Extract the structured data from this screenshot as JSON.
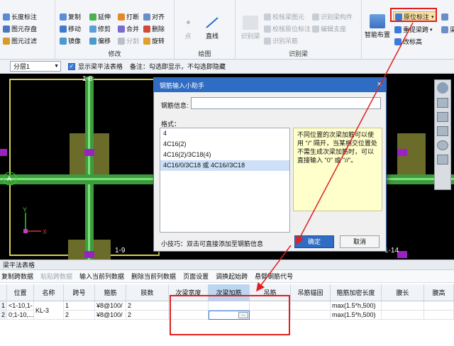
{
  "ribbon": {
    "g1": {
      "items": [
        "长度标注",
        "图元存盘",
        "图元过滤"
      ]
    },
    "g2": {
      "items": [
        [
          "复制",
          "延伸",
          "打断",
          "对齐"
        ],
        [
          "移动",
          "修剪",
          "合并",
          "删除"
        ],
        [
          "镜像",
          "偏移",
          "分割",
          "旋转"
        ]
      ],
      "label": "修改"
    },
    "g3": {
      "items": [
        "点",
        "直线"
      ],
      "label": "绘图"
    },
    "g4": {
      "items": [
        "识别梁",
        "校核梁图元",
        "识别梁构件",
        "校核原位标注",
        "编辑支座",
        "识别吊筋"
      ],
      "label": "识别梁"
    },
    "g5": {
      "smart_layout": "智能布置",
      "orig_mark": "原位标注",
      "redo_span": "重提梁跨",
      "change_elev": "改标高",
      "liang": "梁"
    }
  },
  "toolbar2": {
    "floor": "分层1",
    "show_table": "显示梁平法表格",
    "note": "备注：勾选即显示，不勾选即隐藏"
  },
  "canvas": {
    "labels": [
      "1-8",
      "1-9",
      "1-14",
      "A"
    ]
  },
  "dialog": {
    "title": "钢筋输入小助手",
    "close": "×",
    "rebar_info_label": "钢筋信息:",
    "rebar_info_value": "",
    "format_label": "格式：",
    "formats": [
      "4",
      "4C16(2)",
      "4C16(2)/3C18(4)",
      "4C16/0/3C18 或 4C16//3C18"
    ],
    "hint": "不同位置的次梁加筋可以使用 \"/\" 隔开，当某相交位置处不需生成次梁加筋时，可以直接输入 \"0\" 或 \"//\"。",
    "tip": "小技巧：双击可直接添加至钢筋信息",
    "ok": "确定",
    "cancel": "取消"
  },
  "table": {
    "title": "梁平法表格",
    "toolbar": [
      "复制跨数据",
      "粘贴跨数据",
      "输入当前列数据",
      "删除当前列数据",
      "页面设置",
      "调换起始跨",
      "悬臂钢筋代号"
    ],
    "headers": [
      "位置",
      "名称",
      "跨号",
      "箍筋",
      "肢数",
      "次梁宽度",
      "次梁加筋",
      "吊筋",
      "吊筋锚固",
      "箍筋加密长度",
      "腹长",
      "腹高"
    ],
    "rows": [
      {
        "idx": "1",
        "pos": "<1-10,1-",
        "name": "KL-3",
        "span": "1",
        "stirrup": "¥8@100/",
        "legs": "2",
        "w": "",
        "jia": "",
        "dj": "",
        "mg": "",
        "len": "max(1.5*h,500)"
      },
      {
        "idx": "2",
        "pos": "0;1-10,...",
        "name": "",
        "span": "2",
        "stirrup": "¥8@100/",
        "legs": "2",
        "w": "",
        "jia": "...",
        "dj": "",
        "mg": "",
        "len": "max(1.5*h,500)"
      }
    ]
  }
}
